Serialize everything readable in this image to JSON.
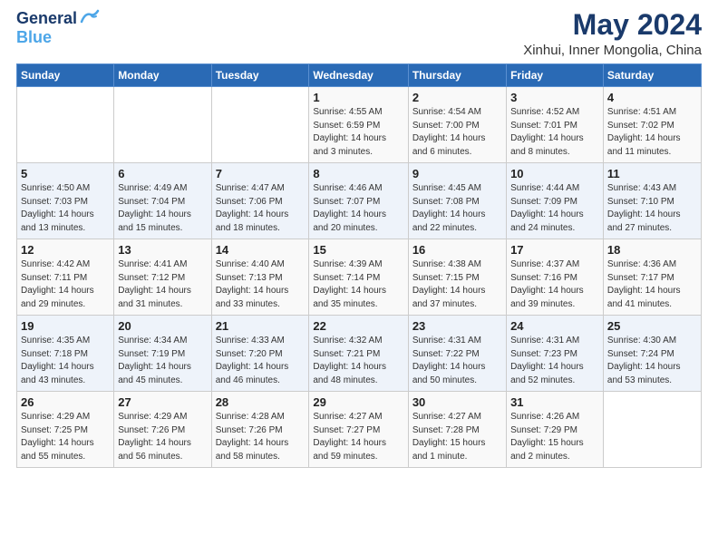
{
  "header": {
    "logo_general": "General",
    "logo_blue": "Blue",
    "main_title": "May 2024",
    "subtitle": "Xinhui, Inner Mongolia, China"
  },
  "weekdays": [
    "Sunday",
    "Monday",
    "Tuesday",
    "Wednesday",
    "Thursday",
    "Friday",
    "Saturday"
  ],
  "weeks": [
    [
      {
        "day": "",
        "info": ""
      },
      {
        "day": "",
        "info": ""
      },
      {
        "day": "",
        "info": ""
      },
      {
        "day": "1",
        "info": "Sunrise: 4:55 AM\nSunset: 6:59 PM\nDaylight: 14 hours\nand 3 minutes."
      },
      {
        "day": "2",
        "info": "Sunrise: 4:54 AM\nSunset: 7:00 PM\nDaylight: 14 hours\nand 6 minutes."
      },
      {
        "day": "3",
        "info": "Sunrise: 4:52 AM\nSunset: 7:01 PM\nDaylight: 14 hours\nand 8 minutes."
      },
      {
        "day": "4",
        "info": "Sunrise: 4:51 AM\nSunset: 7:02 PM\nDaylight: 14 hours\nand 11 minutes."
      }
    ],
    [
      {
        "day": "5",
        "info": "Sunrise: 4:50 AM\nSunset: 7:03 PM\nDaylight: 14 hours\nand 13 minutes."
      },
      {
        "day": "6",
        "info": "Sunrise: 4:49 AM\nSunset: 7:04 PM\nDaylight: 14 hours\nand 15 minutes."
      },
      {
        "day": "7",
        "info": "Sunrise: 4:47 AM\nSunset: 7:06 PM\nDaylight: 14 hours\nand 18 minutes."
      },
      {
        "day": "8",
        "info": "Sunrise: 4:46 AM\nSunset: 7:07 PM\nDaylight: 14 hours\nand 20 minutes."
      },
      {
        "day": "9",
        "info": "Sunrise: 4:45 AM\nSunset: 7:08 PM\nDaylight: 14 hours\nand 22 minutes."
      },
      {
        "day": "10",
        "info": "Sunrise: 4:44 AM\nSunset: 7:09 PM\nDaylight: 14 hours\nand 24 minutes."
      },
      {
        "day": "11",
        "info": "Sunrise: 4:43 AM\nSunset: 7:10 PM\nDaylight: 14 hours\nand 27 minutes."
      }
    ],
    [
      {
        "day": "12",
        "info": "Sunrise: 4:42 AM\nSunset: 7:11 PM\nDaylight: 14 hours\nand 29 minutes."
      },
      {
        "day": "13",
        "info": "Sunrise: 4:41 AM\nSunset: 7:12 PM\nDaylight: 14 hours\nand 31 minutes."
      },
      {
        "day": "14",
        "info": "Sunrise: 4:40 AM\nSunset: 7:13 PM\nDaylight: 14 hours\nand 33 minutes."
      },
      {
        "day": "15",
        "info": "Sunrise: 4:39 AM\nSunset: 7:14 PM\nDaylight: 14 hours\nand 35 minutes."
      },
      {
        "day": "16",
        "info": "Sunrise: 4:38 AM\nSunset: 7:15 PM\nDaylight: 14 hours\nand 37 minutes."
      },
      {
        "day": "17",
        "info": "Sunrise: 4:37 AM\nSunset: 7:16 PM\nDaylight: 14 hours\nand 39 minutes."
      },
      {
        "day": "18",
        "info": "Sunrise: 4:36 AM\nSunset: 7:17 PM\nDaylight: 14 hours\nand 41 minutes."
      }
    ],
    [
      {
        "day": "19",
        "info": "Sunrise: 4:35 AM\nSunset: 7:18 PM\nDaylight: 14 hours\nand 43 minutes."
      },
      {
        "day": "20",
        "info": "Sunrise: 4:34 AM\nSunset: 7:19 PM\nDaylight: 14 hours\nand 45 minutes."
      },
      {
        "day": "21",
        "info": "Sunrise: 4:33 AM\nSunset: 7:20 PM\nDaylight: 14 hours\nand 46 minutes."
      },
      {
        "day": "22",
        "info": "Sunrise: 4:32 AM\nSunset: 7:21 PM\nDaylight: 14 hours\nand 48 minutes."
      },
      {
        "day": "23",
        "info": "Sunrise: 4:31 AM\nSunset: 7:22 PM\nDaylight: 14 hours\nand 50 minutes."
      },
      {
        "day": "24",
        "info": "Sunrise: 4:31 AM\nSunset: 7:23 PM\nDaylight: 14 hours\nand 52 minutes."
      },
      {
        "day": "25",
        "info": "Sunrise: 4:30 AM\nSunset: 7:24 PM\nDaylight: 14 hours\nand 53 minutes."
      }
    ],
    [
      {
        "day": "26",
        "info": "Sunrise: 4:29 AM\nSunset: 7:25 PM\nDaylight: 14 hours\nand 55 minutes."
      },
      {
        "day": "27",
        "info": "Sunrise: 4:29 AM\nSunset: 7:26 PM\nDaylight: 14 hours\nand 56 minutes."
      },
      {
        "day": "28",
        "info": "Sunrise: 4:28 AM\nSunset: 7:26 PM\nDaylight: 14 hours\nand 58 minutes."
      },
      {
        "day": "29",
        "info": "Sunrise: 4:27 AM\nSunset: 7:27 PM\nDaylight: 14 hours\nand 59 minutes."
      },
      {
        "day": "30",
        "info": "Sunrise: 4:27 AM\nSunset: 7:28 PM\nDaylight: 15 hours\nand 1 minute."
      },
      {
        "day": "31",
        "info": "Sunrise: 4:26 AM\nSunset: 7:29 PM\nDaylight: 15 hours\nand 2 minutes."
      },
      {
        "day": "",
        "info": ""
      }
    ]
  ]
}
